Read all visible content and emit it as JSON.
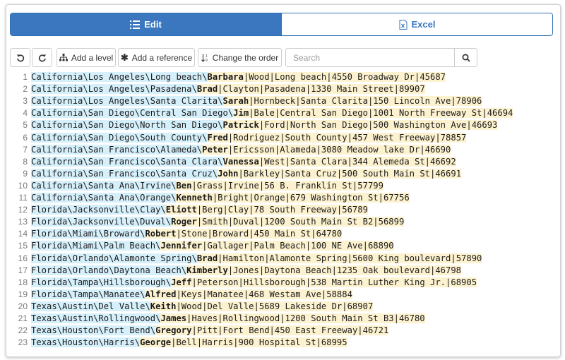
{
  "tabs": [
    {
      "label": "Edit",
      "icon": "list-icon",
      "active": true
    },
    {
      "label": "Excel",
      "icon": "excel-file-icon",
      "active": false
    }
  ],
  "toolbar": {
    "undo_icon": "undo-icon",
    "redo_icon": "redo-icon",
    "add_level": "Add a level",
    "add_reference": "Add a reference",
    "change_order": "Change the order",
    "search_placeholder": "Search",
    "search_icon": "search-icon"
  },
  "colors": {
    "accent": "#3a77bf",
    "path_highlight": "#d6f0fb",
    "value_highlight": "#fdf2cf"
  },
  "editor": {
    "lines": [
      {
        "num": "1",
        "path": "California\\Los Angeles\\Long beach\\",
        "name": "Barbara",
        "rest": "|Wood|Long beach|4550 Broadway Dr|45687"
      },
      {
        "num": "2",
        "path": "California\\Los Angeles\\Pasadena\\",
        "name": "Brad",
        "rest": "|Clayton|Pasadena|1330 Main Street|89907"
      },
      {
        "num": "3",
        "path": "California\\Los Angeles\\Santa Clarita\\",
        "name": "Sarah",
        "rest": "|Hornbeck|Santa Clarita|150 Lincoln Ave|78906"
      },
      {
        "num": "4",
        "path": "California\\San Diego\\Central San Diego\\",
        "name": "Jim",
        "rest": "|Bale|Central San Diego|1001 North Freeway St|46694"
      },
      {
        "num": "5",
        "path": "California\\San Diego\\North San Diego\\",
        "name": "Patrick",
        "rest": "|Ford|North San Diego|500 Washington Ave|46693"
      },
      {
        "num": "6",
        "path": "California\\San Diego\\South County\\",
        "name": "Fred",
        "rest": "|Rodriguez|South County|457 West Freeway|78857"
      },
      {
        "num": "7",
        "path": "California\\San Francisco\\Alameda\\",
        "name": "Peter",
        "rest": "|Ericsson|Alameda|3080 Meadow lake Dr|46690"
      },
      {
        "num": "8",
        "path": "California\\San Francisco\\Santa Clara\\",
        "name": "Vanessa",
        "rest": "|West|Santa Clara|344 Alemeda St|46692"
      },
      {
        "num": "9",
        "path": "California\\San Francisco\\Santa Cruz\\",
        "name": "John",
        "rest": "|Barkley|Santa Cruz|500 South Main St|46691"
      },
      {
        "num": "10",
        "path": "California\\Santa Ana\\Irvine\\",
        "name": "Ben",
        "rest": "|Grass|Irvine|56 B. Franklin St|57799"
      },
      {
        "num": "11",
        "path": "California\\Santa Ana\\Orange\\",
        "name": "Kenneth",
        "rest": "|Bright|Orange|679 Washington St|67756"
      },
      {
        "num": "12",
        "path": "Florida\\Jacksonville\\Clay\\",
        "name": "Eliott",
        "rest": "|Berg|Clay|78 South Freeway|56789"
      },
      {
        "num": "13",
        "path": "Florida\\Jacksonville\\Duval\\",
        "name": "Roger",
        "rest": "|Smith|Duval|1200 South Main St B2|56899"
      },
      {
        "num": "14",
        "path": "Florida\\Miami\\Broward\\",
        "name": "Robert",
        "rest": "|Stone|Broward|450 Main St|64780"
      },
      {
        "num": "15",
        "path": "Florida\\Miami\\Palm Beach\\",
        "name": "Jennifer",
        "rest": "|Gallager|Palm Beach|100 NE Ave|68890"
      },
      {
        "num": "16",
        "path": "Florida\\Orlando\\Alamonte Spring\\",
        "name": "Brad",
        "rest": "|Hamilton|Alamonte Spring|5600 King boulevard|57890"
      },
      {
        "num": "17",
        "path": "Florida\\Orlando\\Daytona Beach\\",
        "name": "Kimberly",
        "rest": "|Jones|Daytona Beach|1235 Oak boulevard|46798"
      },
      {
        "num": "18",
        "path": "Florida\\Tampa\\Hillsborough\\",
        "name": "Jeff",
        "rest": "|Peterson|Hillsborough|538 Martin Luther King Jr.|68905"
      },
      {
        "num": "19",
        "path": "Florida\\Tampa\\Manatee\\",
        "name": "Alfred",
        "rest": "|Keys|Manatee|468 Westam Ave|58884"
      },
      {
        "num": "20",
        "path": "Texas\\Austin\\Del Valle\\",
        "name": "Keith",
        "rest": "|Wood|Del Valle|5689 Lakeside Dr|68907"
      },
      {
        "num": "21",
        "path": "Texas\\Austin\\Rollingwood\\",
        "name": "James",
        "rest": "|Haves|Rollingwood|1200 South Main St B3|46780"
      },
      {
        "num": "22",
        "path": "Texas\\Houston\\Fort Bend\\",
        "name": "Gregory",
        "rest": "|Pitt|Fort Bend|450 East Freeway|46721"
      },
      {
        "num": "23",
        "path": "Texas\\Houston\\Harris\\",
        "name": "George",
        "rest": "|Bell|Harris|900 Hospital St|68995"
      }
    ]
  }
}
